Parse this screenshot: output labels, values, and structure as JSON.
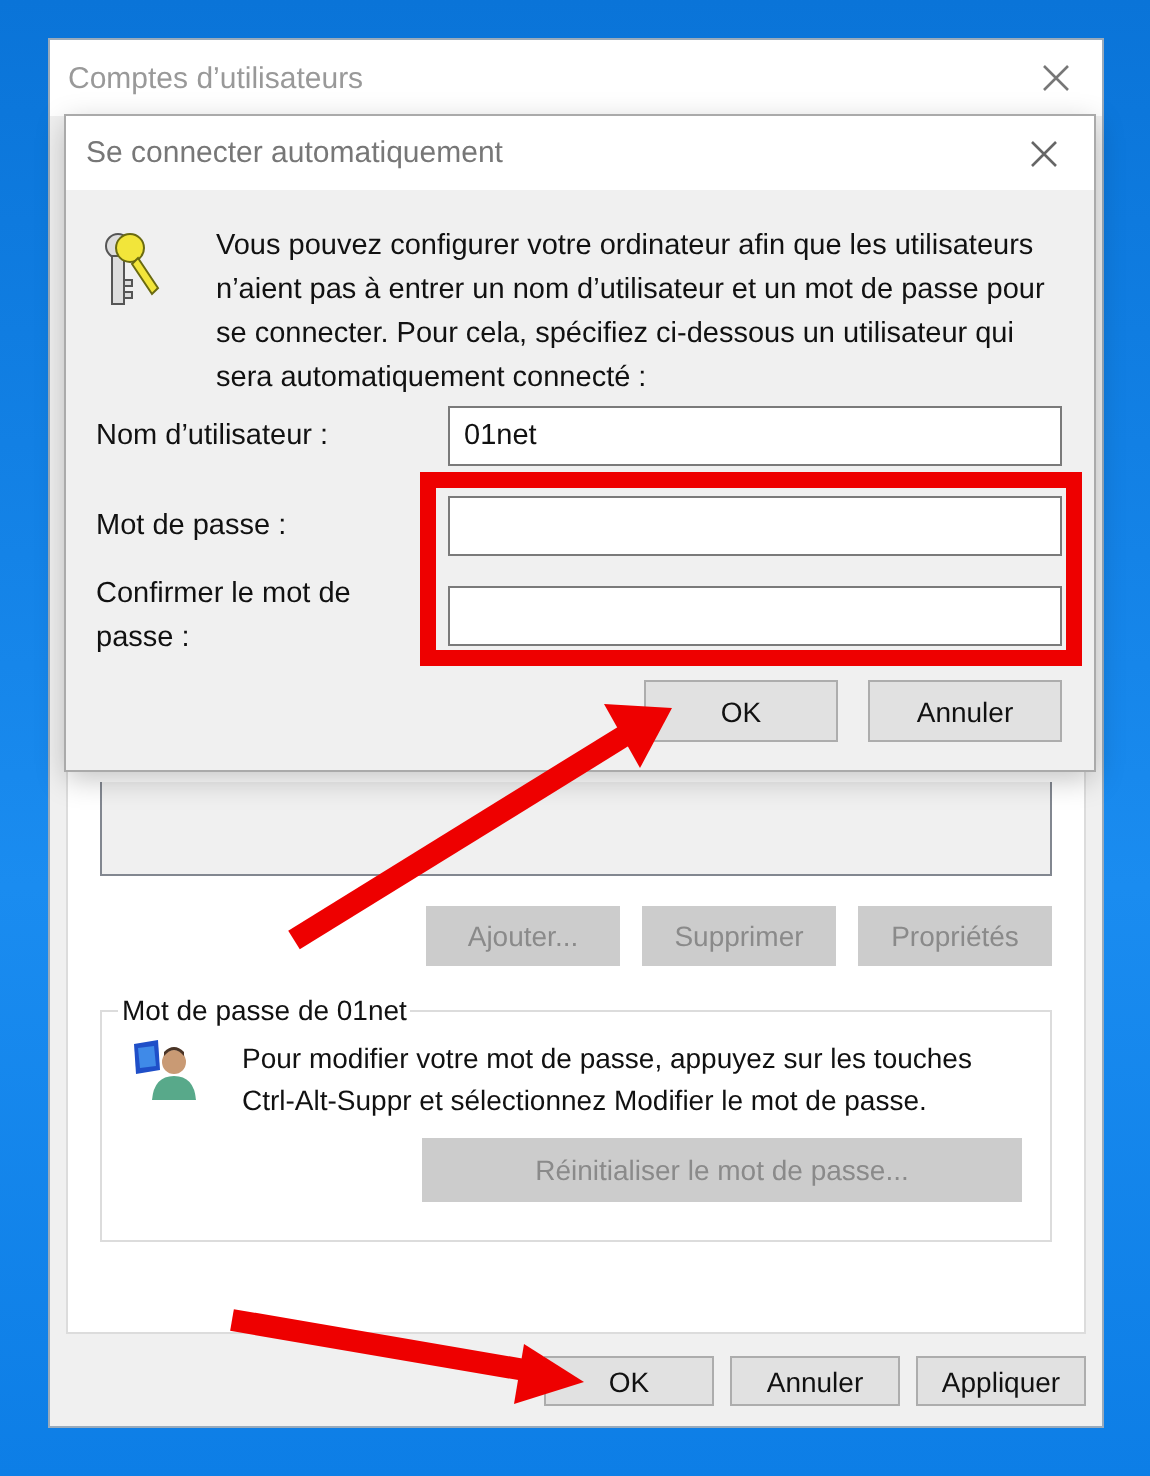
{
  "window": {
    "title": "Comptes d’utilisateurs",
    "active": false
  },
  "list_buttons": [
    {
      "label": "Ajouter...",
      "disabled": true
    },
    {
      "label": "Supprimer",
      "disabled": true
    },
    {
      "label": "Propriétés",
      "disabled": true
    }
  ],
  "password_group": {
    "title": "Mot de passe de 01net",
    "text": "Pour modifier votre mot de passe, appuyez sur les touches Ctrl-Alt-Suppr et sélectionnez Modifier le mot de passe.",
    "button": {
      "label": "Réinitialiser le mot de passe...",
      "disabled": true
    }
  },
  "footer_buttons": [
    {
      "label": "OK",
      "disabled": false
    },
    {
      "label": "Annuler",
      "disabled": false
    },
    {
      "label": "Appliquer",
      "disabled": false
    }
  ],
  "dialog": {
    "title": "Se connecter automatiquement",
    "active": true,
    "text": "Vous pouvez configurer votre ordinateur afin que les utilisateurs n’aient pas à entrer un nom d’utilisateur et un mot de passe pour se connecter. Pour cela, spécifiez ci-dessous un utilisateur qui sera automatiquement connecté :",
    "fields": [
      {
        "label": "Nom d’utilisateur :",
        "value": "01net"
      },
      {
        "label": "Mot de passe :"
      },
      {
        "label": "Confirmer le mot de passe :"
      }
    ],
    "buttons": [
      {
        "label": "OK",
        "disabled": false
      },
      {
        "label": "Annuler",
        "disabled": false
      }
    ]
  }
}
